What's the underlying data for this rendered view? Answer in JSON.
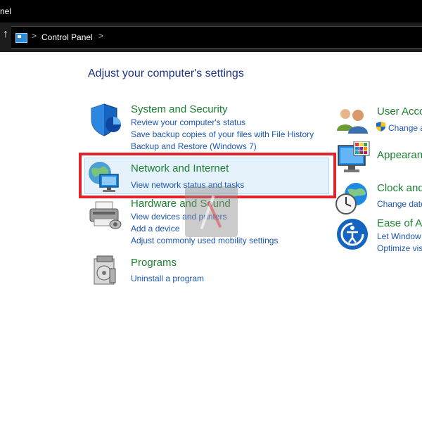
{
  "window": {
    "title_partial": "nel"
  },
  "address_bar": {
    "up_glyph": "↑",
    "separator": ">",
    "crumb": "Control Panel"
  },
  "heading": "Adjust your computer's settings",
  "left_categories": [
    {
      "title": "System and Security",
      "links": [
        "Review your computer's status",
        "Save backup copies of your files with File History",
        "Backup and Restore (Windows 7)"
      ]
    },
    {
      "title": "Network and Internet",
      "links": [
        "View network status and tasks"
      ]
    },
    {
      "title": "Hardware and Sound",
      "links": [
        "View devices and printers",
        "Add a device",
        "Adjust commonly used mobility settings"
      ]
    },
    {
      "title": "Programs",
      "links": [
        "Uninstall a program"
      ]
    }
  ],
  "right_categories": [
    {
      "title": "User Acco",
      "links": [
        "Change a"
      ]
    },
    {
      "title": "Appearan",
      "links": []
    },
    {
      "title": "Clock and",
      "links": [
        "Change date"
      ]
    },
    {
      "title": "Ease of A",
      "links": [
        "Let Window",
        "Optimize vis"
      ]
    }
  ],
  "colors": {
    "category_title": "#1a7f2e",
    "link": "#1b56b4",
    "heading": "#1e3287",
    "highlight_border": "#e1242b",
    "highlight_fill": "#e5f2fc"
  },
  "icons": {
    "system_security": "shield-icon",
    "network_internet": "network-globe-icon",
    "hardware_sound": "printer-icon",
    "programs": "programs-box-icon",
    "user_accounts": "users-icon",
    "appearance": "monitor-palette-icon",
    "clock": "clock-globe-icon",
    "ease_of_access": "ease-of-access-icon"
  }
}
